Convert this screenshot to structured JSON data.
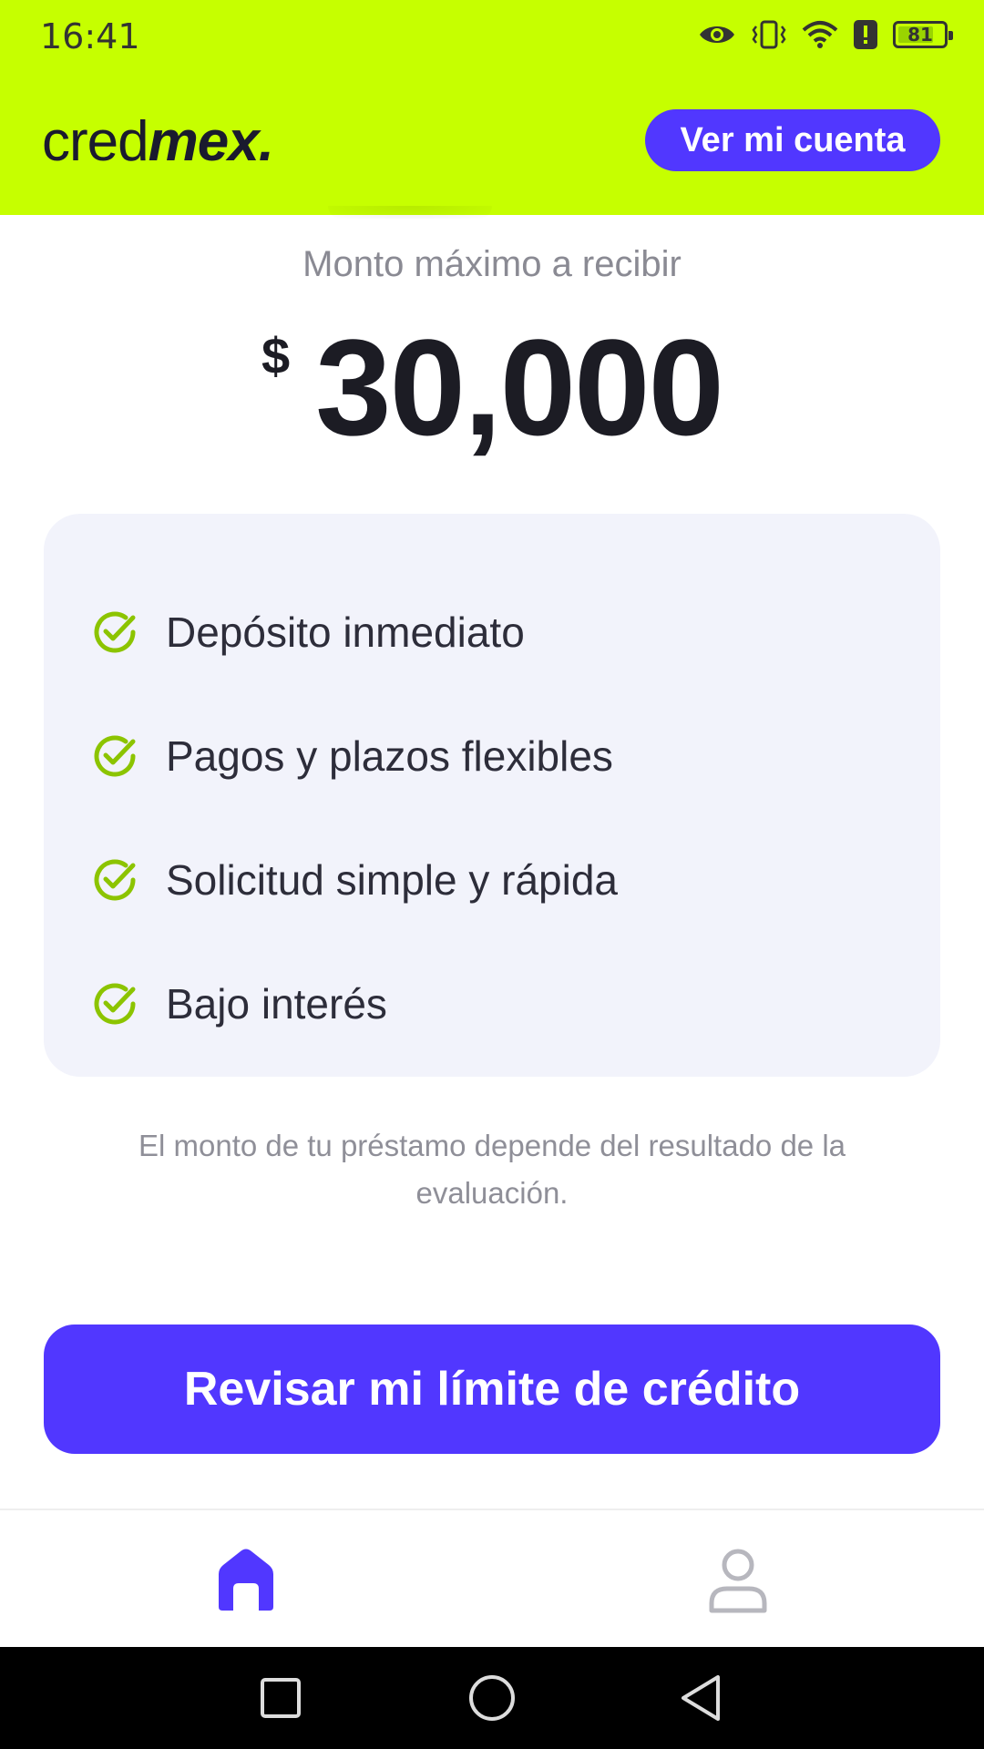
{
  "status_bar": {
    "time": "16:41",
    "battery_level": "81",
    "icons": [
      "eye-icon",
      "vibrate-icon",
      "wifi-icon",
      "alert-icon",
      "battery-icon"
    ]
  },
  "header": {
    "logo_light": "cred",
    "logo_bold": "mex.",
    "account_button": "Ver mi cuenta",
    "background_color": "#c6ff00",
    "accent_color": "#5137ff"
  },
  "offer": {
    "label": "Monto máximo a recibir",
    "currency": "$",
    "amount": "30,000"
  },
  "features": [
    {
      "text": "Depósito inmediato",
      "icon": "check-circle-icon"
    },
    {
      "text": "Pagos y plazos flexibles",
      "icon": "check-circle-icon"
    },
    {
      "text": "Solicitud simple y rápida",
      "icon": "check-circle-icon"
    },
    {
      "text": "Bajo interés",
      "icon": "check-circle-icon"
    }
  ],
  "disclaimer": "El monto de tu préstamo depende del resultado de la evaluación.",
  "cta": {
    "label": "Revisar mi límite de crédito"
  },
  "bottom_nav": {
    "items": [
      {
        "name": "home",
        "icon": "home-icon",
        "active": true
      },
      {
        "name": "profile",
        "icon": "user-icon",
        "active": false
      }
    ]
  },
  "system_nav": [
    "recents-square-icon",
    "home-circle-icon",
    "back-triangle-icon"
  ]
}
